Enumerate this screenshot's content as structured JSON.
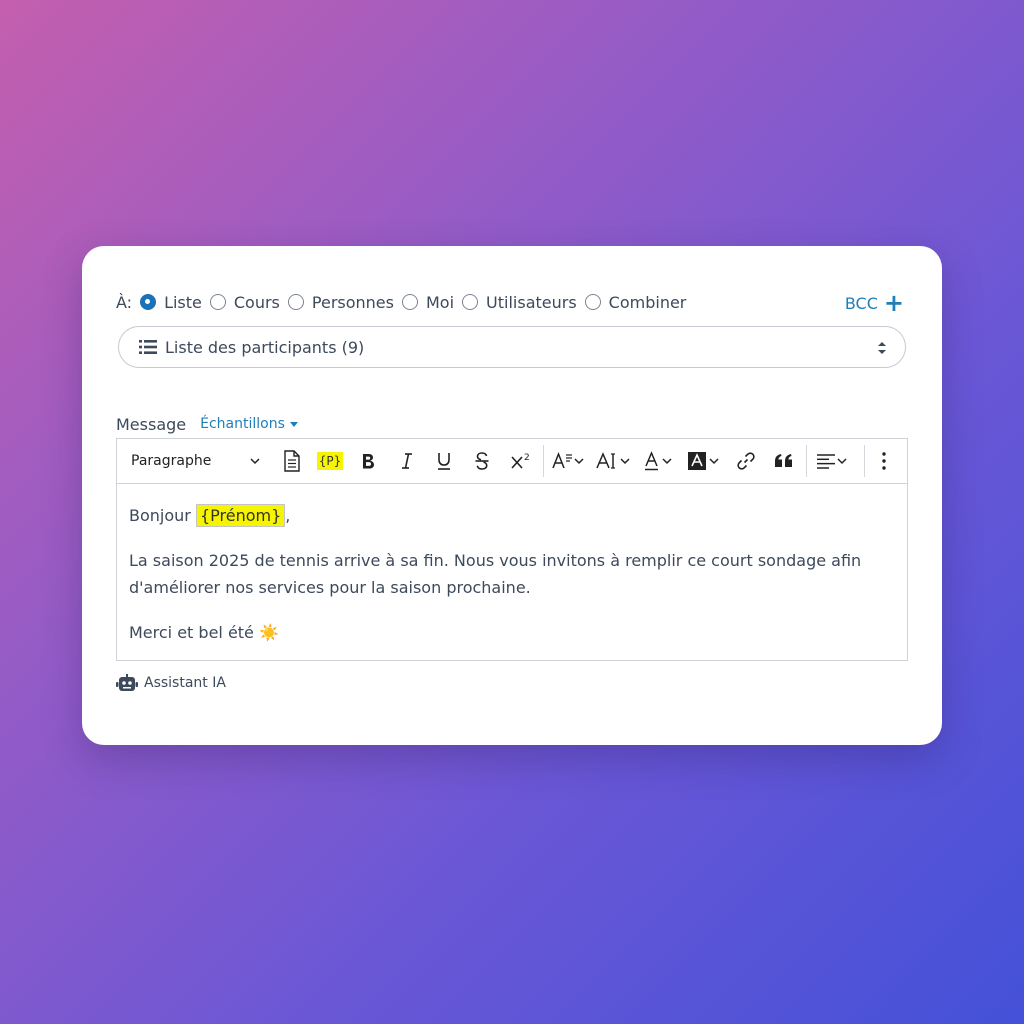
{
  "recipients": {
    "label": "À:",
    "options": [
      {
        "label": "Liste",
        "checked": true
      },
      {
        "label": "Cours",
        "checked": false
      },
      {
        "label": "Personnes",
        "checked": false
      },
      {
        "label": "Moi",
        "checked": false
      },
      {
        "label": "Utilisateurs",
        "checked": false
      },
      {
        "label": "Combiner",
        "checked": false
      }
    ],
    "bcc_label": "BCC",
    "selected_list": "Liste des participants (9)"
  },
  "message": {
    "label": "Message",
    "samples_label": "Échantillons",
    "toolbar": {
      "paragraph_style": "Paragraphe",
      "placeholder_token": "{P}"
    },
    "body": {
      "greeting": "Bonjour",
      "name_token": "{Prénom}",
      "greeting_suffix": ",",
      "paragraph": "La saison 2025 de tennis arrive à sa fin. Nous vous invitons à remplir ce court sondage afin d'améliorer nos services pour la saison prochaine.",
      "closing": "Merci et bel été",
      "closing_emoji": "☀️"
    },
    "assistant_label": "Assistant IA"
  },
  "colors": {
    "accent": "#1a73b8",
    "link": "#1f7fb8",
    "highlight": "#f6f400"
  }
}
